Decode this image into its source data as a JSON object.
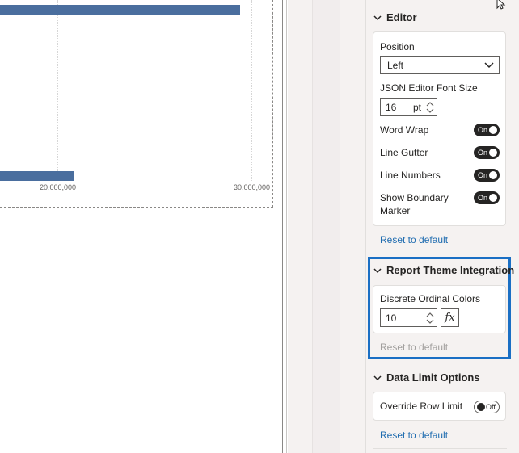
{
  "chart": {
    "ticks": [
      "20,000,000",
      "30,000,000"
    ]
  },
  "editor": {
    "header": "Editor",
    "position_label": "Position",
    "position_value": "Left",
    "font_size_label": "JSON Editor Font Size",
    "font_size_value": "16",
    "font_size_unit": "pt",
    "toggles": [
      {
        "label": "Word Wrap",
        "state": "On"
      },
      {
        "label": "Line Gutter",
        "state": "On"
      },
      {
        "label": "Line Numbers",
        "state": "On"
      },
      {
        "label": "Show Boundary\nMarker",
        "state": "On"
      }
    ],
    "reset": "Reset to default"
  },
  "theme": {
    "header": "Report Theme Integration",
    "colors_label": "Discrete Ordinal Colors",
    "colors_value": "10",
    "fx_label": "fx",
    "reset": "Reset to default"
  },
  "data_limit": {
    "header": "Data Limit Options",
    "override_label": "Override Row Limit",
    "override_state": "Off",
    "reset": "Reset to default"
  },
  "colors": {
    "accent": "#1a6fc4",
    "bar": "#4a6e9e",
    "link": "#1f6cb0"
  },
  "icons": [
    "chevron-down-icon",
    "cursor-icon"
  ]
}
